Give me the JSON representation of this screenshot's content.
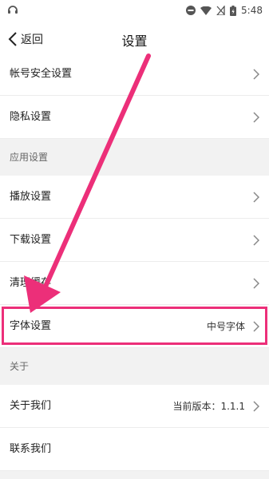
{
  "status_bar": {
    "time": "5:48",
    "icons": [
      "headset-icon",
      "dnd-icon",
      "wifi-icon",
      "no-sim-icon",
      "battery-icon"
    ]
  },
  "nav": {
    "back_label": "返回",
    "title": "设置"
  },
  "rows": {
    "account_security": {
      "label": "帐号安全设置"
    },
    "privacy": {
      "label": "隐私设置"
    },
    "playback": {
      "label": "播放设置"
    },
    "download": {
      "label": "下载设置"
    },
    "clear_cache": {
      "label": "清理缓存"
    },
    "font": {
      "label": "字体设置",
      "value": "中号字体"
    },
    "about_us": {
      "label": "关于我们",
      "value": "当前版本：1.1.1"
    },
    "contact": {
      "label": "联系我们"
    }
  },
  "sections": {
    "app_settings": "应用设置",
    "about": "关于"
  },
  "colors": {
    "accent": "#ec2f79",
    "section_bg": "#f2f2f2",
    "divider": "#ececec"
  }
}
